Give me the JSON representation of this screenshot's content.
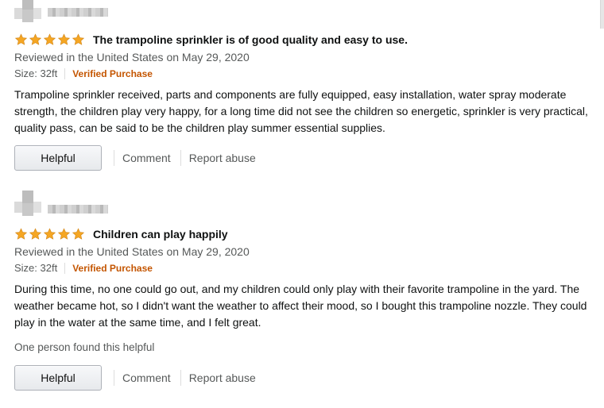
{
  "colors": {
    "star": "#f5a623",
    "verified": "#c45500",
    "muted": "#565959",
    "text": "#0f1111"
  },
  "reviews": [
    {
      "rating": 5,
      "title": "The trampoline sprinkler is of good quality and easy to use.",
      "date_line": "Reviewed in the United States on May 29, 2020",
      "size": "Size: 32ft",
      "verified": "Verified Purchase",
      "body": "Trampoline sprinkler received, parts and components are fully equipped, easy installation, water spray moderate strength, the children play very happy, for a long time did not see the children so energetic, sprinkler is very practical, quality pass, can be said to be the children play summer essential supplies.",
      "helpful_count": "",
      "helpful_label": "Helpful",
      "comment_label": "Comment",
      "report_label": "Report abuse"
    },
    {
      "rating": 5,
      "title": "Children can play happily",
      "date_line": "Reviewed in the United States on May 29, 2020",
      "size": "Size: 32ft",
      "verified": "Verified Purchase",
      "body": "During this time, no one could go out, and my children could only play with their favorite trampoline in the yard. The weather became hot, so I didn't want the weather to affect their mood, so I bought this trampoline nozzle. They could play in the water at the same time, and I felt great.",
      "helpful_count": "One person found this helpful",
      "helpful_label": "Helpful",
      "comment_label": "Comment",
      "report_label": "Report abuse"
    }
  ]
}
